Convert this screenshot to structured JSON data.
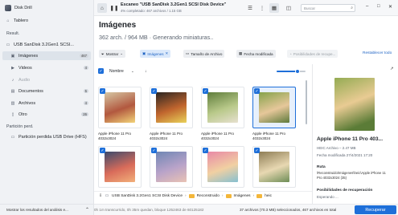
{
  "app": {
    "title": "Disk Drill"
  },
  "sidebar": {
    "home": {
      "label": "Tablero"
    },
    "results_header": "Result.",
    "device": {
      "label": "USB SanDisk 3.2Gen1 SCSI..."
    },
    "items": [
      {
        "label": "Imágenes",
        "count": "467"
      },
      {
        "label": "Videos",
        "count": "4"
      },
      {
        "label": "Audio",
        "count": ""
      },
      {
        "label": "Documentos",
        "count": "5"
      },
      {
        "label": "Archivos",
        "count": "4"
      },
      {
        "label": "Otro",
        "count": "26"
      }
    ],
    "lost_header": "Partición perd.",
    "lost_partition": {
      "label": "Partición perdida USB Drive (HFS)"
    },
    "footer": {
      "label": "Mostrar los resultados del análisis e..."
    }
  },
  "topbar": {
    "scan_title": "Escaneo \"USB SanDisk 3.2Gen1 SCSI Disk Device\"",
    "scan_subtitle": "4% completado: 467 archivos / 1.15 GB",
    "search_placeholder": "Buscar"
  },
  "header": {
    "title": "Imágenes",
    "subtitle": "362 arch. / 964 MB · Generando miniaturas.."
  },
  "filters": {
    "show": "Mostrar",
    "images": "Imágenes",
    "size": "Tamaño de Archivo",
    "modified": "Fecha modificada",
    "recovery": "Posibilidades de recupe...",
    "reset": "Restablecer todo"
  },
  "content_header": {
    "name_label": "Nombre",
    "zoom_fraction": 0.72
  },
  "tiles": [
    {
      "caption": "Apple iPhone 11 Pro 4032x3024",
      "selected": false,
      "colors": [
        "#d6c7a4",
        "#b2583f",
        "#f3d47a"
      ]
    },
    {
      "caption": "Apple iPhone 11 Pro 4032x3024",
      "selected": false,
      "colors": [
        "#2b2522",
        "#c0652e",
        "#e9d25a"
      ]
    },
    {
      "caption": "Apple iPhone 11 Pro 4032x3024",
      "selected": false,
      "colors": [
        "#5f7d3b",
        "#b9c98a",
        "#e7e0d0"
      ]
    },
    {
      "caption": "Apple iPhone 11 Pro 4032x3024",
      "selected": true,
      "colors": [
        "#86a24b",
        "#e6c79a",
        "#5d7a3b"
      ]
    },
    {
      "caption": "",
      "selected": false,
      "colors": [
        "#3b4a6c",
        "#d86b5a",
        "#f2b07a"
      ]
    },
    {
      "caption": "",
      "selected": false,
      "colors": [
        "#6f86b4",
        "#b9a3c9",
        "#e9c2b4"
      ]
    },
    {
      "caption": "",
      "selected": false,
      "colors": [
        "#e889a6",
        "#f1d0a2",
        "#86c0d1"
      ]
    },
    {
      "caption": "",
      "selected": false,
      "colors": [
        "#8e7d55",
        "#e8d8b2",
        "#6d8d56"
      ]
    }
  ],
  "preview": {
    "title": "Apple iPhone 11 Pro 403...",
    "type_size": "HEIC Archivo – 2.47 MB",
    "modified": "Fecha modificada 27/4/2021 17:20",
    "path_label": "Ruta",
    "path_value": "\\Reconstruido\\Imágenes\\heic\\Apple iPhone 11 Pro 4032x3024 (35)",
    "recovery_label": "Posibilidades de recuperación",
    "recovery_value": "Esperando ...",
    "colors": [
      "#94ab53",
      "#e9cb93",
      "#5b7c37"
    ]
  },
  "pathbar": {
    "segments": [
      "USB SanDisk 3.2Gen1 SCSI Disk Device",
      "Reconstruido",
      "Imágenes",
      "heic"
    ]
  },
  "statusbar": {
    "left": "0h 1m transcurrido, 0h 35m quedan, bloque 1252463 de 60125182",
    "right": "37 archivos (70.3 MB) seleccionados, 467 archivos en total",
    "recover": "Recuperar"
  }
}
